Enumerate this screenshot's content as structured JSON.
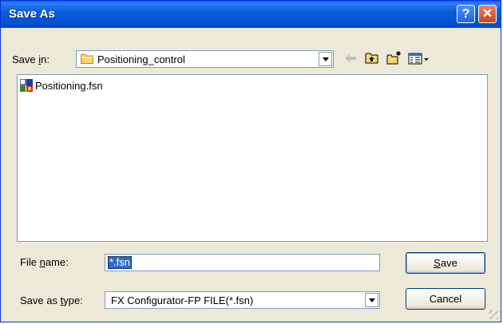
{
  "window": {
    "title": "Save As",
    "help_label": "?",
    "close_label": "✕"
  },
  "save_in": {
    "label_prefix": "Save ",
    "label_hotkey": "i",
    "label_suffix": "n:",
    "folder": "Positioning_control"
  },
  "toolbar": {
    "icons": [
      "back-arrow-icon",
      "up-folder-icon",
      "new-folder-icon",
      "view-menu-icon"
    ]
  },
  "files": [
    {
      "name": "Positioning.fsn",
      "icon": "fsn-file-icon"
    }
  ],
  "file_name": {
    "label_prefix": "File ",
    "label_hotkey": "n",
    "label_suffix": "ame:",
    "value": "*.fsn"
  },
  "save_type": {
    "label_prefix": "Save as ",
    "label_hotkey": "t",
    "label_suffix": "ype:",
    "value": "FX Configurator-FP FILE(*.fsn)"
  },
  "buttons": {
    "save_hotkey": "S",
    "save_rest": "ave",
    "cancel": "Cancel"
  }
}
